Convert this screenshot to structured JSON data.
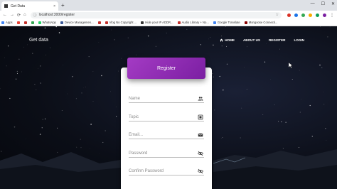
{
  "browser": {
    "tab_title": "Get Data",
    "tab_close": "×",
    "new_tab": "+",
    "url": "localhost:3000/register",
    "window_controls": [
      "—",
      "☐",
      "✕"
    ]
  },
  "bookmarks": [
    {
      "label": "Apps",
      "color": "#4285f4"
    },
    {
      "label": "",
      "color": "#ea4335"
    },
    {
      "label": "",
      "color": "#c4302b"
    },
    {
      "label": "",
      "color": "#34a853"
    },
    {
      "label": "WhatsApp",
      "color": "#25d366"
    },
    {
      "label": "Device Managemen...",
      "color": "#3b5998"
    },
    {
      "label": "",
      "color": "#c4302b"
    },
    {
      "label": "Vlog No Copyright ...",
      "color": "#c4302b"
    },
    {
      "label": "Hide your IP ADDR...",
      "color": "#333333"
    },
    {
      "label": "Audio Library + No...",
      "color": "#c4302b"
    },
    {
      "label": "Google Translate",
      "color": "#4285f4"
    },
    {
      "label": "Mongoose Connecti...",
      "color": "#880000"
    }
  ],
  "site": {
    "brand": "Get data",
    "nav": [
      {
        "label": "HOME",
        "icon": "home-icon"
      },
      {
        "label": "ABOUT US"
      },
      {
        "label": "REGISTER"
      },
      {
        "label": "LOGIN"
      }
    ]
  },
  "form": {
    "header": "Register",
    "fields": [
      {
        "label": "Name",
        "icon": "people-icon"
      },
      {
        "label": "Topic",
        "icon": "topic-icon"
      },
      {
        "label": "Email...",
        "icon": "email-icon"
      },
      {
        "label": "Password",
        "icon": "visibility-off-icon"
      },
      {
        "label": "Confirm Password",
        "icon": "visibility-off-icon"
      }
    ]
  },
  "colors": {
    "header_gradient_start": "#a43bc4",
    "header_gradient_end": "#7b1fa2"
  }
}
